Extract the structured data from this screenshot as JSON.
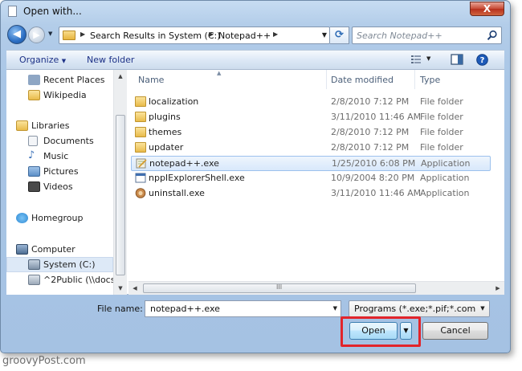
{
  "window": {
    "title": "Open with...",
    "close_glyph": "X"
  },
  "nav": {
    "back_glyph": "◀",
    "forward_glyph": "▶",
    "breadcrumbs": [
      "Search Results in System (C:)",
      "Notepad++"
    ],
    "refresh_glyph": "⟳",
    "search_placeholder": "Search Notepad++"
  },
  "toolbar": {
    "organize_label": "Organize",
    "new_folder_label": "New folder"
  },
  "sidebar": {
    "items": [
      {
        "label": "Recent Places",
        "icon": "recent-places-icon",
        "color": "#8ea6c4"
      },
      {
        "label": "Wikipedia",
        "icon": "folder-icon",
        "color": "#e9bb4a"
      },
      {
        "label": "Libraries",
        "icon": "libraries-icon",
        "color": "#e9bb4a"
      },
      {
        "label": "Documents",
        "icon": "documents-icon",
        "color": "#dfe6ef"
      },
      {
        "label": "Music",
        "icon": "music-icon",
        "color": "#3d72b8"
      },
      {
        "label": "Pictures",
        "icon": "pictures-icon",
        "color": "#5c8fc7"
      },
      {
        "label": "Videos",
        "icon": "videos-icon",
        "color": "#4a4a4a"
      },
      {
        "label": "Homegroup",
        "icon": "homegroup-icon",
        "color": "#2f8ad4"
      },
      {
        "label": "Computer",
        "icon": "computer-icon",
        "color": "#4d6d92"
      },
      {
        "label": "System (C:)",
        "icon": "drive-icon",
        "color": "#7f92a8"
      },
      {
        "label": "^2Public (\\\\docs",
        "icon": "network-drive-icon",
        "color": "#c94040"
      }
    ]
  },
  "files": {
    "columns": {
      "name": "Name",
      "date": "Date modified",
      "type": "Type"
    },
    "rows": [
      {
        "name": "localization",
        "date": "2/8/2010 7:12 PM",
        "type": "File folder",
        "icon": "folder-icon"
      },
      {
        "name": "plugins",
        "date": "3/11/2010 11:46 AM",
        "type": "File folder",
        "icon": "folder-icon"
      },
      {
        "name": "themes",
        "date": "2/8/2010 7:12 PM",
        "type": "File folder",
        "icon": "folder-icon"
      },
      {
        "name": "updater",
        "date": "2/8/2010 7:12 PM",
        "type": "File folder",
        "icon": "folder-icon"
      },
      {
        "name": "notepad++.exe",
        "date": "1/25/2010 6:08 PM",
        "type": "Application",
        "icon": "notepad-exe-icon",
        "selected": true
      },
      {
        "name": "nppIExplorerShell.exe",
        "date": "10/9/2004 8:20 PM",
        "type": "Application",
        "icon": "application-icon"
      },
      {
        "name": "uninstall.exe",
        "date": "3/11/2010 11:46 AM",
        "type": "Application",
        "icon": "uninstall-icon"
      }
    ]
  },
  "footer": {
    "filename_label": "File name:",
    "filename_value": "notepad++.exe",
    "filter_value": "Programs (*.exe;*.pif;*.com;*.ba",
    "open_label": "Open",
    "cancel_label": "Cancel",
    "highlight_color": "#e2242a"
  },
  "watermark": "groovyPost.com"
}
